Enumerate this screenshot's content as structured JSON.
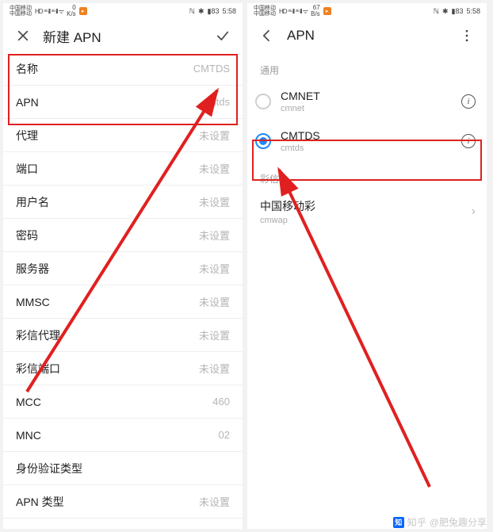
{
  "statusbar": {
    "carrier1": "中国移动",
    "carrier2": "中国移动",
    "signal": "HD ⁴⁶ ill ⁴⁶ ill ᯤ",
    "speed_top": "0",
    "speed_bot": "K/s",
    "speed_top_r": "67",
    "speed_bot_r": "B/s",
    "nfc": "ℕ",
    "bt": "✱",
    "batt": "83",
    "time": "5:58"
  },
  "left": {
    "title": "新建 APN",
    "rows": [
      {
        "label": "名称",
        "value": "CMTDS"
      },
      {
        "label": "APN",
        "value": "cmtds"
      },
      {
        "label": "代理",
        "value": "未设置"
      },
      {
        "label": "端口",
        "value": "未设置"
      },
      {
        "label": "用户名",
        "value": "未设置"
      },
      {
        "label": "密码",
        "value": "未设置"
      },
      {
        "label": "服务器",
        "value": "未设置"
      },
      {
        "label": "MMSC",
        "value": "未设置"
      },
      {
        "label": "彩信代理",
        "value": "未设置"
      },
      {
        "label": "彩信端口",
        "value": "未设置"
      },
      {
        "label": "MCC",
        "value": "460"
      },
      {
        "label": "MNC",
        "value": "02"
      },
      {
        "label": "身份验证类型",
        "value": ""
      },
      {
        "label": "APN 类型",
        "value": "未设置"
      }
    ]
  },
  "right": {
    "title": "APN",
    "section1": "通用",
    "items": [
      {
        "name": "CMNET",
        "sub": "cmnet",
        "selected": false
      },
      {
        "name": "CMTDS",
        "sub": "cmtds",
        "selected": true
      }
    ],
    "section2": "彩信",
    "mms": {
      "name": "中国移动彩",
      "sub": "cmwap"
    }
  },
  "watermark": {
    "site": "知乎",
    "author": "@肥兔趣分享"
  }
}
